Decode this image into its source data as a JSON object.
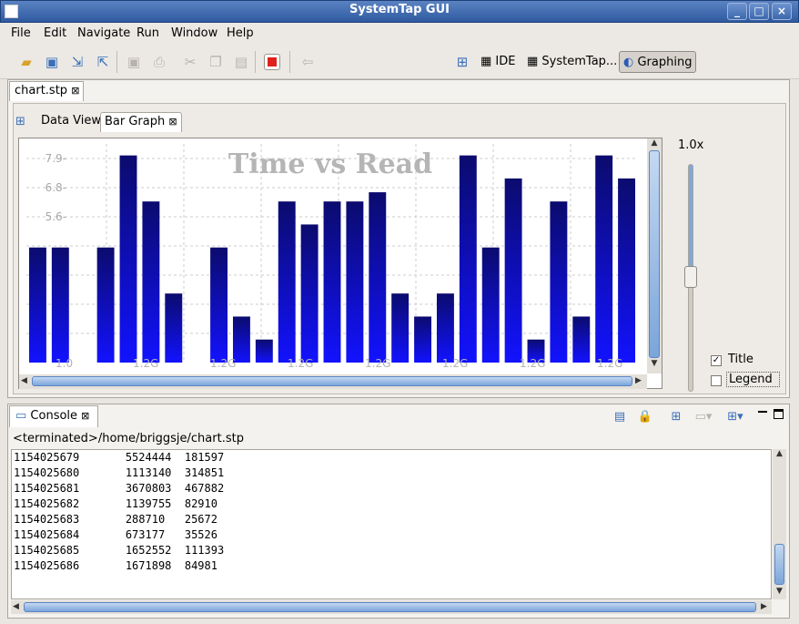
{
  "window": {
    "title": "SystemTap GUI"
  },
  "menu": {
    "items": [
      "File",
      "Edit",
      "Navigate",
      "Run",
      "Window",
      "Help"
    ]
  },
  "perspectives": {
    "ide": "IDE",
    "systemtap": "SystemTap...",
    "graphing": "Graphing"
  },
  "editor": {
    "tab_label": "chart.stp"
  },
  "inner_tabs": {
    "data_view": "Data View",
    "bar_graph": "Bar Graph"
  },
  "chart_data": {
    "type": "bar",
    "title": "Time vs Read",
    "yticks": [
      "7.9",
      "6.8",
      "5.6"
    ],
    "xticks": [
      "1.0",
      "1.2G",
      "1.2G",
      "1.2G",
      "1.2G",
      "1.2G",
      "1.2G",
      "1.2G"
    ],
    "values": [
      5,
      5,
      0,
      5,
      9,
      7,
      3,
      0,
      5,
      2,
      1,
      7,
      6,
      7,
      7,
      7.4,
      3,
      2,
      3,
      9,
      5,
      8,
      1,
      7,
      2,
      9,
      8
    ],
    "ymax": 9.5,
    "grid": true,
    "legend": "none"
  },
  "side": {
    "zoom": "1.0x",
    "title_label": "Title",
    "legend_label": "Legend",
    "title_checked": true,
    "legend_checked": false
  },
  "console": {
    "tab_label": "Console",
    "status": "<terminated>/home/briggsje/chart.stp",
    "lines": [
      "1154025679       5524444  181597",
      "1154025680       1113140  314851",
      "1154025681       3670803  467882",
      "1154025682       1139755  82910",
      "1154025683       288710   25672",
      "1154025684       673177   35526",
      "1154025685       1652552  111393",
      "1154025686       1671898  84981"
    ]
  }
}
